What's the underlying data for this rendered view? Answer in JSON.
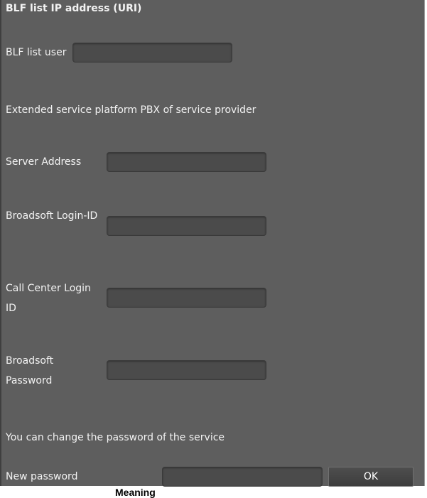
{
  "header": {
    "title": "BLF list IP address (URI)"
  },
  "blf": {
    "user_label": "BLF list user",
    "user_value": ""
  },
  "extended": {
    "section_label": "Extended service platform PBX of service provider"
  },
  "server_address": {
    "label": "Server Address",
    "value": ""
  },
  "broadsoft_login": {
    "label": "Broadsoft Login-ID",
    "value": ""
  },
  "call_center": {
    "label": "Call Center Login ID",
    "value": ""
  },
  "broadsoft_password": {
    "label": "Broadsoft Password",
    "value": ""
  },
  "password_change": {
    "info": "You can change the password of the service",
    "new_label": "New password",
    "new_value": "",
    "ok_label": "OK"
  },
  "footer": {
    "meaning_text": "Meaning"
  }
}
